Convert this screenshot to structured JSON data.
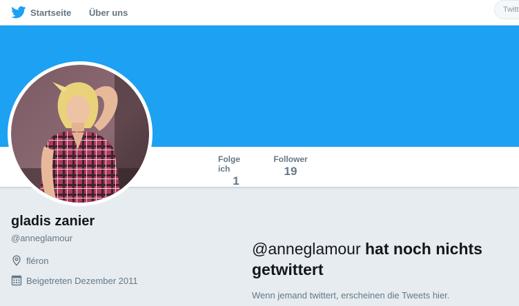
{
  "nav": {
    "home_label": "Startseite",
    "about_label": "Über uns",
    "search_placeholder": "Twitter durchsuchen",
    "brand_icon": "twitter-bird-icon"
  },
  "colors": {
    "brand": "#1da1f2",
    "banner": "#1da1f2",
    "page_bg": "#e6ecf0",
    "secondary_text": "#657786"
  },
  "profile_nav": {
    "following_label": "Folge ich",
    "following_count": "1",
    "followers_label": "Follower",
    "followers_count": "19"
  },
  "profile": {
    "name": "gladis zanier",
    "handle": "@anneglamour",
    "location": "fléron",
    "joined": "Beigetreten Dezember 2011"
  },
  "timeline": {
    "empty_handle": "@anneglamour",
    "empty_title_rest": "hat noch nichts",
    "empty_title_line2": "getwittert",
    "empty_subtitle": "Wenn jemand twittert, erscheinen die Tweets hier."
  }
}
